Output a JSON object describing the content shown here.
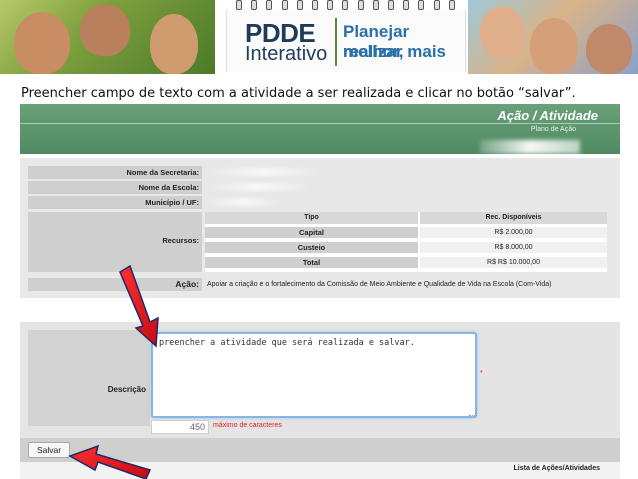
{
  "banner": {
    "logo_title": "PDDE",
    "logo_subtitle": "Interativo",
    "slogan_line1": "Planejar melhor,",
    "slogan_line2": "realizar mais"
  },
  "instruction": "Preencher campo de texto com a atividade a ser realizada e clicar no botão “salvar”.",
  "header": {
    "title": "Ação / Atividade",
    "subtitle": "Plano de Ação"
  },
  "info": {
    "secretaria_label": "Nome da Secretaria:",
    "escola_label": "Nome da Escola:",
    "municipio_label": "Município / UF:",
    "recursos_label": "Recursos:",
    "acao_label": "Ação:",
    "acao_value": "Apoiar a criação e o fortalecimento da Comissão de Meio Ambiente e Qualidade de Vida na Escola (Com-Vida)"
  },
  "recursos": {
    "col_tipo": "Tipo",
    "col_rec": "Rec. Disponíveis",
    "rows": [
      {
        "tipo": "Capital",
        "valor": "R$ 2.000,00"
      },
      {
        "tipo": "Custeio",
        "valor": "R$ 8.000,00"
      },
      {
        "tipo": "Total",
        "valor": "R$ R$ 10.000,00"
      }
    ]
  },
  "form": {
    "descricao_label": "Descrição",
    "descricao_value": "preencher a atividade que será realizada e salvar.",
    "char_count": "450",
    "char_label": "máximo de caracteres",
    "required_mark": "*",
    "save_label": "Salvar"
  },
  "list": {
    "title": "Lista de Ações/Atividades"
  },
  "colors": {
    "header_green": "#4f8a62",
    "arrow_red": "#e0121a",
    "slogan_blue": "#2a6fa8",
    "counter_red": "#e02020"
  },
  "icons": [
    "red-arrow-icon"
  ]
}
